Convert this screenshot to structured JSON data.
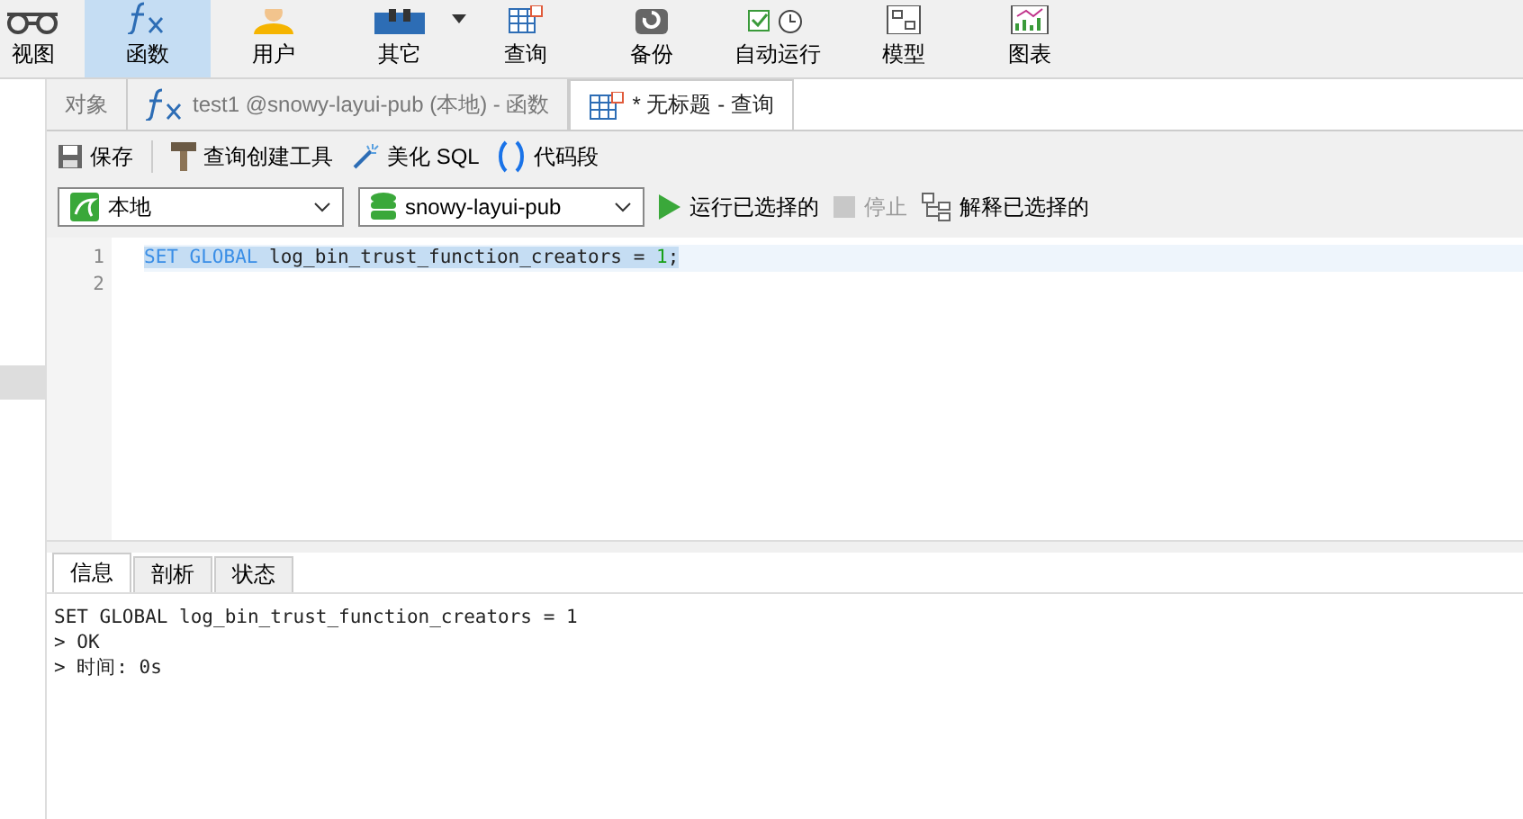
{
  "ribbon": [
    {
      "label": "视图",
      "kind": "glasses",
      "selected": false
    },
    {
      "label": "函数",
      "kind": "fx",
      "selected": true
    },
    {
      "label": "用户",
      "kind": "user",
      "selected": false
    },
    {
      "label": "其它",
      "kind": "box",
      "selected": false,
      "dropdown": true
    },
    {
      "label": "查询",
      "kind": "grid",
      "selected": false
    },
    {
      "label": "备份",
      "kind": "backup",
      "selected": false
    },
    {
      "label": "自动运行",
      "kind": "schedule",
      "selected": false
    },
    {
      "label": "模型",
      "kind": "model",
      "selected": false
    },
    {
      "label": "图表",
      "kind": "chart",
      "selected": false
    }
  ],
  "tabs": [
    {
      "label": "对象",
      "kind": "plain",
      "selected": false
    },
    {
      "label": "test1 @snowy-layui-pub (本地) - 函数",
      "kind": "fx",
      "selected": false
    },
    {
      "label": "* 无标题 - 查询",
      "kind": "grid",
      "selected": true
    }
  ],
  "toolbar": [
    {
      "label": "保存",
      "kind": "save"
    },
    {
      "label": "查询创建工具",
      "kind": "hammer"
    },
    {
      "label": "美化 SQL",
      "kind": "wand"
    },
    {
      "label": "代码段",
      "kind": "braces"
    }
  ],
  "connection": {
    "value": "本地"
  },
  "database": {
    "value": "snowy-layui-pub"
  },
  "actions": [
    {
      "label": "运行已选择的",
      "kind": "run",
      "disabled": false
    },
    {
      "label": "停止",
      "kind": "stop",
      "disabled": true
    },
    {
      "label": "解释已选择的",
      "kind": "explain",
      "disabled": false
    }
  ],
  "editor": {
    "lines": [
      {
        "number": "1",
        "selected": true,
        "tokens": [
          {
            "kind": "keyword",
            "text": "SET GLOBAL"
          },
          {
            "kind": "plain",
            "text": " log_bin_trust_function_creators = "
          },
          {
            "kind": "number",
            "text": "1"
          },
          {
            "kind": "plain",
            "text": ";"
          }
        ]
      },
      {
        "number": "2",
        "selected": false
      }
    ]
  },
  "result_tabs": [
    {
      "label": "信息",
      "selected": true
    },
    {
      "label": "剖析",
      "selected": false
    },
    {
      "label": "状态",
      "selected": false
    }
  ],
  "messages": [
    "SET GLOBAL log_bin_trust_function_creators = 1",
    "> OK",
    "> 时间: 0s"
  ]
}
